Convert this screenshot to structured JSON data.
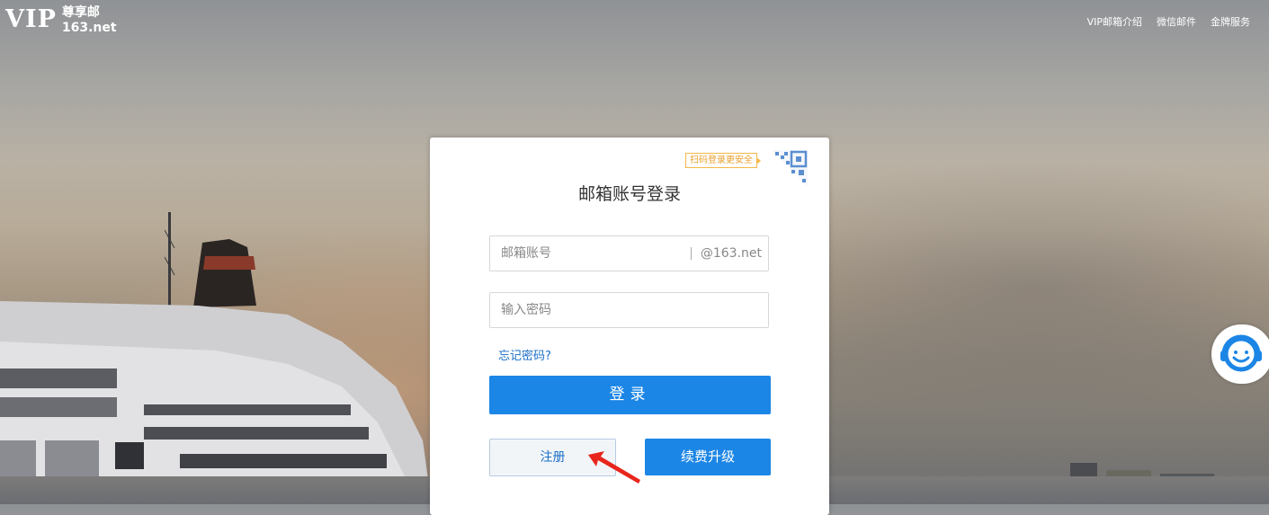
{
  "header": {
    "logo": {
      "vip": "VIP",
      "name_cn": "尊享邮",
      "domain": "163.net"
    },
    "nav": [
      "VIP邮箱介绍",
      "微信邮件",
      "金牌服务"
    ]
  },
  "login_card": {
    "qr_tip": "扫码登录更安全",
    "title": "邮箱账号登录",
    "account_placeholder": "邮箱账号",
    "account_suffix": "@163.net",
    "password_placeholder": "输入密码",
    "forgot_password": "忘记密码?",
    "login_button": "登录",
    "register_button": "注册",
    "upgrade_button": "续费升级"
  },
  "colors": {
    "primary": "#1c86e6",
    "link": "#1a6ec8",
    "tip": "#f5b84a",
    "arrow": "#e8261c"
  },
  "icons": [
    "qr-code-icon",
    "customer-service-icon",
    "red-arrow-annotation"
  ]
}
